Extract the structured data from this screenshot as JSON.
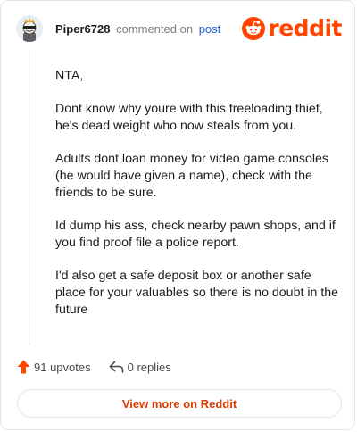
{
  "header": {
    "username": "Piper6728",
    "action_text": "commented on",
    "post_link": "post"
  },
  "brand": {
    "wordmark": "reddit",
    "color": "#ff4500"
  },
  "comment": {
    "paragraphs": [
      "NTA,",
      "Dont know why youre with this freeloading thief, he's dead weight who now steals from you.",
      "Adults dont loan money for video game consoles (he would have given a name), check with the friends to be sure.",
      "Id dump his ass, check nearby pawn shops, and if you find proof file a police report.",
      "I'd also get a safe deposit box or another safe place for your valuables so there is no doubt in the future"
    ]
  },
  "actions": {
    "upvotes_label": "91 upvotes",
    "replies_label": "0 replies",
    "upvote_icon": "upvote-arrow-icon",
    "reply_icon": "reply-arrow-icon"
  },
  "footer": {
    "view_more_label": "View more on Reddit"
  },
  "colors": {
    "accent": "#ff4500",
    "link": "#1a5fd6",
    "button_text": "#d93a00"
  }
}
